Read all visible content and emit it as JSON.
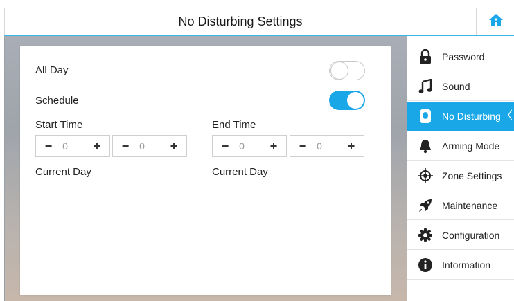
{
  "header": {
    "title": "No Disturbing Settings"
  },
  "icons": {
    "home": "home-icon"
  },
  "colors": {
    "accent": "#1aa7e8",
    "header_line": "#39b5e6"
  },
  "settings": {
    "all_day": {
      "label": "All Day",
      "enabled": false
    },
    "schedule": {
      "label": "Schedule",
      "enabled": true
    },
    "start": {
      "label": "Start Time",
      "hour": "0",
      "minute": "0",
      "day": "Current Day"
    },
    "end": {
      "label": "End Time",
      "hour": "0",
      "minute": "0",
      "day": "Current Day"
    },
    "minus": "−",
    "plus": "+"
  },
  "sidebar": {
    "items": [
      {
        "label": "Password",
        "icon": "lock-icon",
        "active": false
      },
      {
        "label": "Sound",
        "icon": "music-note-icon",
        "active": false
      },
      {
        "label": "No Disturbing",
        "icon": "do-not-disturb-icon",
        "active": true,
        "marker": "〈"
      },
      {
        "label": "Arming Mode",
        "icon": "bell-icon",
        "active": false
      },
      {
        "label": "Zone Settings",
        "icon": "zone-target-icon",
        "active": false
      },
      {
        "label": "Maintenance",
        "icon": "rocket-icon",
        "active": false
      },
      {
        "label": "Configuration",
        "icon": "gear-icon",
        "active": false
      },
      {
        "label": "Information",
        "icon": "info-icon",
        "active": false
      }
    ]
  }
}
